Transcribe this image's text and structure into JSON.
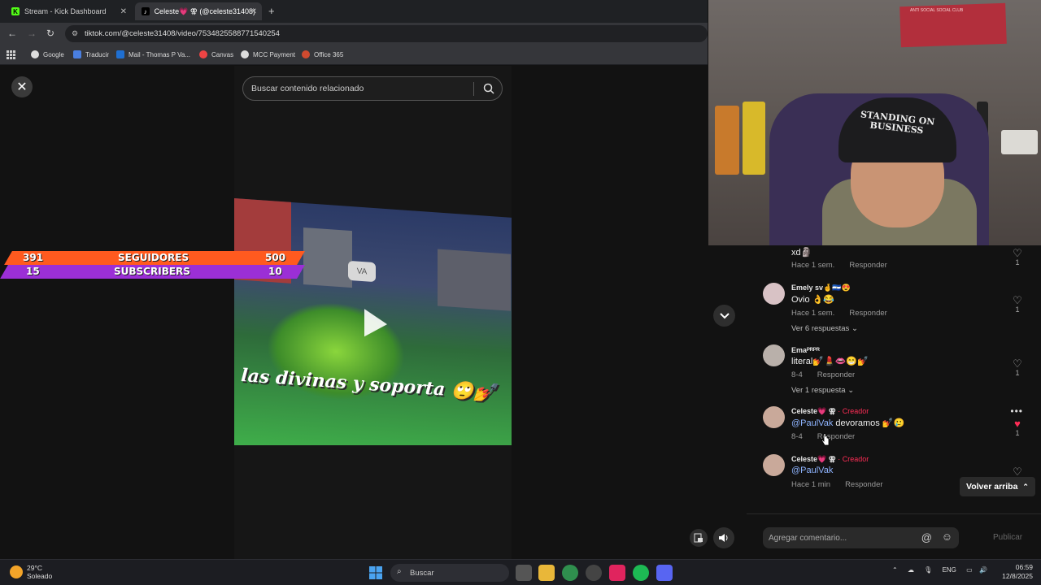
{
  "browser": {
    "tabs": [
      {
        "label": "Stream - Kick Dashboard",
        "favicon": "kick-icon",
        "color": "#53fc18"
      },
      {
        "label": "Celeste💗 ⚢ (@celeste31408)",
        "favicon": "tiktok-icon",
        "color": "#000000"
      }
    ],
    "url": "tiktok.com/@celeste31408/video/7534825588771540254",
    "bookmarks": [
      "Google",
      "Traducir",
      "Mail - Thomas P Va...",
      "Canvas",
      "MCC Payment",
      "Office 365"
    ]
  },
  "viewer": {
    "search_placeholder": "Buscar contenido relacionado",
    "video_caption": "las divinas y soporta 🙄💅",
    "bubble_text": "VA"
  },
  "overlay": {
    "followers_current": "391",
    "followers_label": "SEGUIDORES",
    "followers_goal": "500",
    "subs_current": "15",
    "subs_label": "SUBSCRIBERS",
    "subs_goal": "10",
    "followers_color": "#ff5a1f",
    "subs_color": "#9b2fd6"
  },
  "webcam": {
    "cap_text": "STANDING ON BUSINESS",
    "poster_text": "ANTI SOCIAL SOCIAL CLUB"
  },
  "comments": [
    {
      "name": "",
      "text": "xd🗿",
      "date": "Hace 1 sem.",
      "reply": "Responder",
      "likes": "1",
      "liked": false
    },
    {
      "name": "Emely sv🤞🇸🇻😍",
      "text": "Ovio 👌😂",
      "date": "Hace 1 sem.",
      "reply": "Responder",
      "likes": "1",
      "liked": false,
      "more": "Ver 6 respuestas"
    },
    {
      "name": "Emaᴾᴿᴾᴿ",
      "text": "literal💅💄👄😁💅",
      "date": "8-4",
      "reply": "Responder",
      "likes": "1",
      "liked": false,
      "more": "Ver 1 respuesta"
    },
    {
      "name": "Celeste💗 ⚢",
      "badge": "· Creador",
      "mention": "@PaulVak",
      "text": " devoramos 💅🥲",
      "date": "8-4",
      "reply": "Responder",
      "likes": "1",
      "liked": true
    },
    {
      "name": "Celeste💗 ⚢",
      "badge": "· Creador",
      "mention": "@PaulVak",
      "text": "",
      "date": "Hace 1 min",
      "reply": "Responder",
      "likes": "",
      "liked": false
    }
  ],
  "back_to_top": "Volver arriba",
  "comment_placeholder": "Agregar comentario...",
  "publish_label": "Publicar",
  "taskbar": {
    "weather_temp": "29°C",
    "weather_desc": "Soleado",
    "search_label": "Buscar",
    "lang": "ENG",
    "time": "06:59",
    "date": "12/8/2025"
  }
}
